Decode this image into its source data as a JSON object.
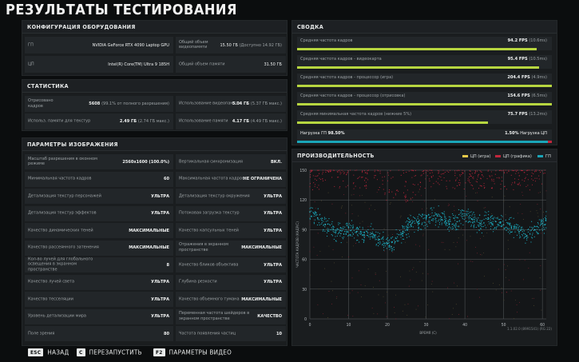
{
  "title": "РЕЗУЛЬТАТЫ ТЕСТИРОВАНИЯ",
  "hardware": {
    "header": "КОНФИГУРАЦИЯ ОБОРУДОВАНИЯ",
    "gpu_label": "ГП",
    "gpu_value": "NVIDIA GeForce RTX 4090 Laptop GPU",
    "vram_label": "Общий объем видеопамяти",
    "vram_value": "15.50 ГБ",
    "vram_sub": "(Доступно 14.92 ГБ)",
    "cpu_label": "ЦП",
    "cpu_value": "Intel(R) Core(TM) Ultra 9 185H",
    "ram_label": "Общий объем памяти",
    "ram_value": "31.50 ГБ"
  },
  "stats": {
    "header": "СТАТИСТИКА",
    "frames_label": "Отрисовано кадров",
    "frames_value": "5608",
    "frames_sub": "(99.1% от полного разрешения)",
    "vram_use_label": "Использование видеопамяти",
    "vram_use_value": "5.04 ГБ",
    "vram_use_sub": "(5.37 ГБ макс.)",
    "tex_label": "Использ. памяти для текстур",
    "tex_value": "2.49 ГБ",
    "tex_sub": "(2.74 ГБ макс.)",
    "mem_label": "Использование памяти",
    "mem_value": "4.17 ГБ",
    "mem_sub": "(4.49 ГБ макс.)"
  },
  "image": {
    "header": "ПАРАМЕТРЫ ИЗОБРАЖЕНИЯ",
    "rows": [
      {
        "l1": "Масштаб разрешения в оконном режиме",
        "v1": "2560x1600 (100.0%)",
        "l2": "Вертикальная синхронизация",
        "v2": "ВКЛ."
      },
      {
        "l1": "Минимальная частота кадров",
        "v1": "60",
        "l2": "Максимальная частота кадров",
        "v2": "НЕ ОГРАНИЧЕНА"
      },
      {
        "l1": "Детализация текстур персонажей",
        "v1": "УЛЬТРА",
        "l2": "Детализация текстур окружения",
        "v2": "УЛЬТРА"
      },
      {
        "l1": "Детализация текстур эффектов",
        "v1": "УЛЬТРА",
        "l2": "Потоковая загрузка текстур",
        "v2": "УЛЬТРА"
      },
      {
        "l1": "Качество динамических теней",
        "v1": "МАКСИМАЛЬНЫЕ",
        "l2": "Качество капсульных теней",
        "v2": "УЛЬТРА"
      },
      {
        "l1": "Качество рассеянного затенения",
        "v1": "МАКСИМАЛЬНЫЕ",
        "l2": "Отражения в экранном пространстве",
        "v2": "МАКСИМАЛЬНЫЕ"
      },
      {
        "l1": "Кол-во лучей для глобального освещения в экранном пространстве",
        "v1": "8",
        "l2": "Качество бликов объектива",
        "v2": "УЛЬТРА"
      },
      {
        "l1": "Качество лучей света",
        "v1": "УЛЬТРА",
        "l2": "Глубина резкости",
        "v2": "УЛЬТРА"
      },
      {
        "l1": "Качество тесселяции",
        "v1": "УЛЬТРА",
        "l2": "Качество объемного тумана",
        "v2": "МАКСИМАЛЬНЫЕ"
      },
      {
        "l1": "Уровень детализации мира",
        "v1": "УЛЬТРА",
        "l2": "Переменная частота шейдеров в экранном пространстве",
        "v2": "КАЧЕСТВО"
      },
      {
        "l1": "Поле зрения",
        "v1": "80",
        "l2": "Частота появления частиц",
        "v2": "10"
      }
    ]
  },
  "summary": {
    "header": "СВОДКА",
    "rows": [
      {
        "label": "Средняя частота кадров",
        "value": "94.2 FPS",
        "sub": "(10.6ms)",
        "fill": 0.94
      },
      {
        "label": "Средняя частота кадров - видеокарта",
        "value": "95.4 FPS",
        "sub": "(10.5ms)",
        "fill": 0.95
      },
      {
        "label": "Средняя частота кадров - процессор (игра)",
        "value": "204.4 FPS",
        "sub": "(4.9ms)",
        "fill": 1.0
      },
      {
        "label": "Средняя частота кадров - процессор (отрисовка)",
        "value": "154.6 FPS",
        "sub": "(6.5ms)",
        "fill": 1.0
      },
      {
        "label": "Средняя минимальная частота кадров (нижние 5%)",
        "value": "75.7 FPS",
        "sub": "(13.2ms)",
        "fill": 0.75
      }
    ],
    "load_label_left": "Нагрузка ГП",
    "load_value_left": "98.50%",
    "load_value_right": "1.50%",
    "load_label_right": "Нагрузка ЦП",
    "load_gpu_fraction": 0.985,
    "color_bar": "#b7d640",
    "color_gpu": "#1aa5b8",
    "color_cpu": "#c0263c"
  },
  "perf": {
    "header": "ПРОИЗВОДИТЕЛЬНОСТЬ",
    "legend": [
      {
        "name": "ЦП (игра)",
        "color": "#e6c94a"
      },
      {
        "name": "ЦП (графика)",
        "color": "#c0263c"
      },
      {
        "name": "ГП",
        "color": "#1aa5b8"
      }
    ],
    "version": "1.1.02.0 (8991541) (RG 22)"
  },
  "chart_data": {
    "type": "scatter",
    "xlabel": "ВРЕМЯ (С)",
    "ylabel": "ЧАСТОТА КАДРОВ (КАДР/С)",
    "xlim": [
      0,
      61
    ],
    "ylim": [
      0,
      150
    ],
    "xticks": [
      0,
      10,
      20,
      30,
      40,
      50,
      60
    ],
    "yticks": [
      0,
      30,
      60,
      90,
      120,
      150
    ],
    "grid": true,
    "legend_position": "top-right",
    "series": [
      {
        "name": "ЦП (графика)",
        "color": "#c0263c",
        "band": [
          130,
          150
        ],
        "trend": "top edge, denser 20-27 s"
      },
      {
        "name": "ГП",
        "color": "#1aa5b8",
        "points": [
          [
            0,
            108
          ],
          [
            2,
            102
          ],
          [
            4,
            95
          ],
          [
            6,
            90
          ],
          [
            8,
            86
          ],
          [
            10,
            92
          ],
          [
            12,
            88
          ],
          [
            14,
            84
          ],
          [
            16,
            86
          ],
          [
            18,
            80
          ],
          [
            20,
            76
          ],
          [
            21,
            73
          ],
          [
            22,
            78
          ],
          [
            24,
            88
          ],
          [
            26,
            95
          ],
          [
            28,
            98
          ],
          [
            30,
            102
          ],
          [
            32,
            104
          ],
          [
            34,
            100
          ],
          [
            36,
            96
          ],
          [
            38,
            98
          ],
          [
            40,
            104
          ],
          [
            42,
            100
          ],
          [
            44,
            96
          ],
          [
            46,
            102
          ],
          [
            48,
            98
          ],
          [
            50,
            95
          ],
          [
            52,
            92
          ],
          [
            54,
            88
          ],
          [
            56,
            84
          ],
          [
            58,
            90
          ],
          [
            60,
            96
          ]
        ]
      },
      {
        "name": "ЦП (игра)",
        "color": "#e6c94a",
        "band": [
          0,
          130
        ],
        "trend": "sparse scatter"
      }
    ]
  },
  "footer": [
    {
      "key": "ESC",
      "label": "НАЗАД"
    },
    {
      "key": "C",
      "label": "ПЕРЕЗАПУСТИТЬ"
    },
    {
      "key": "F2",
      "label": "ПАРАМЕТРЫ ВИДЕО"
    }
  ]
}
